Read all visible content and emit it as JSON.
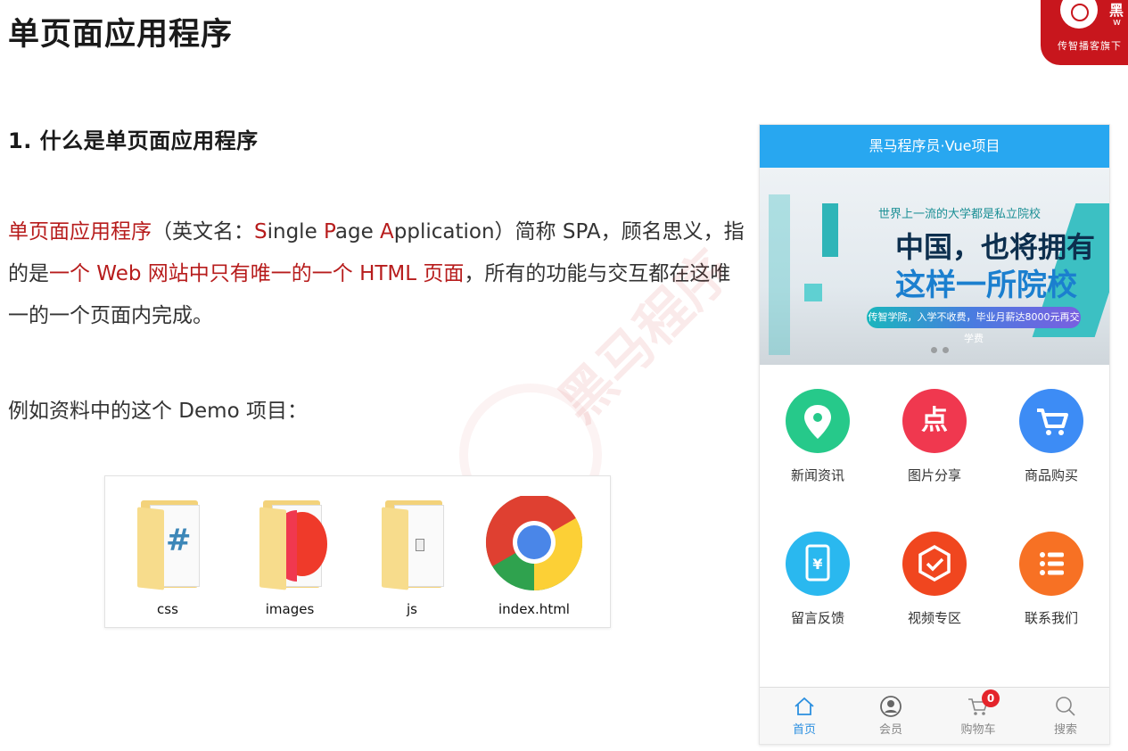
{
  "page": {
    "title": "单页面应用程序",
    "logo": {
      "brand": "黑",
      "www": "w",
      "tagline": "传智播客旗下"
    },
    "section_heading": "1. 什么是单页面应用程序",
    "paragraph": {
      "term": "单页面应用程序",
      "part1": "（英文名：",
      "s": "S",
      "ingle": "ingle ",
      "p": "P",
      "age": "age ",
      "a": "A",
      "pplication": "pplication",
      "part2": "）简称 SPA，顾名思义，指的是",
      "highlight": "一个 Web 网站中只有唯一的一个 HTML 页面",
      "part3": "，所有的功能与交互都在这唯一的一个页面内完成。"
    },
    "example_line": "例如资料中的这个 Demo 项目：",
    "files": [
      {
        "name": "css"
      },
      {
        "name": "images"
      },
      {
        "name": "js"
      },
      {
        "name": "index.html"
      }
    ]
  },
  "phone": {
    "header": "黑马程序员·Vue项目",
    "banner": {
      "slogan": "世界上一流的大学都是私立院校",
      "line1": "中国，也将拥有",
      "line2": "这样一所院校",
      "strip": "传智学院，入学不收费，毕业月薪达8000元再交学费"
    },
    "grid": [
      {
        "label": "新闻资讯",
        "icon": "location-pin-icon",
        "color": "#26c98a"
      },
      {
        "label": "图片分享",
        "icon": "photo-share-icon",
        "color": "#f0384f"
      },
      {
        "label": "商品购买",
        "icon": "shopping-cart-icon",
        "color": "#3d8cf5"
      },
      {
        "label": "留言反馈",
        "icon": "yen-phone-icon",
        "color": "#2ab8ef"
      },
      {
        "label": "视频专区",
        "icon": "video-check-icon",
        "color": "#f0461f"
      },
      {
        "label": "联系我们",
        "icon": "list-icon",
        "color": "#f77124"
      }
    ],
    "tabs": [
      {
        "label": "首页",
        "icon": "home-icon",
        "active": true
      },
      {
        "label": "会员",
        "icon": "user-icon",
        "active": false
      },
      {
        "label": "购物车",
        "icon": "cart-icon",
        "active": false,
        "badge": "0"
      },
      {
        "label": "搜索",
        "icon": "search-icon",
        "active": false
      }
    ]
  }
}
